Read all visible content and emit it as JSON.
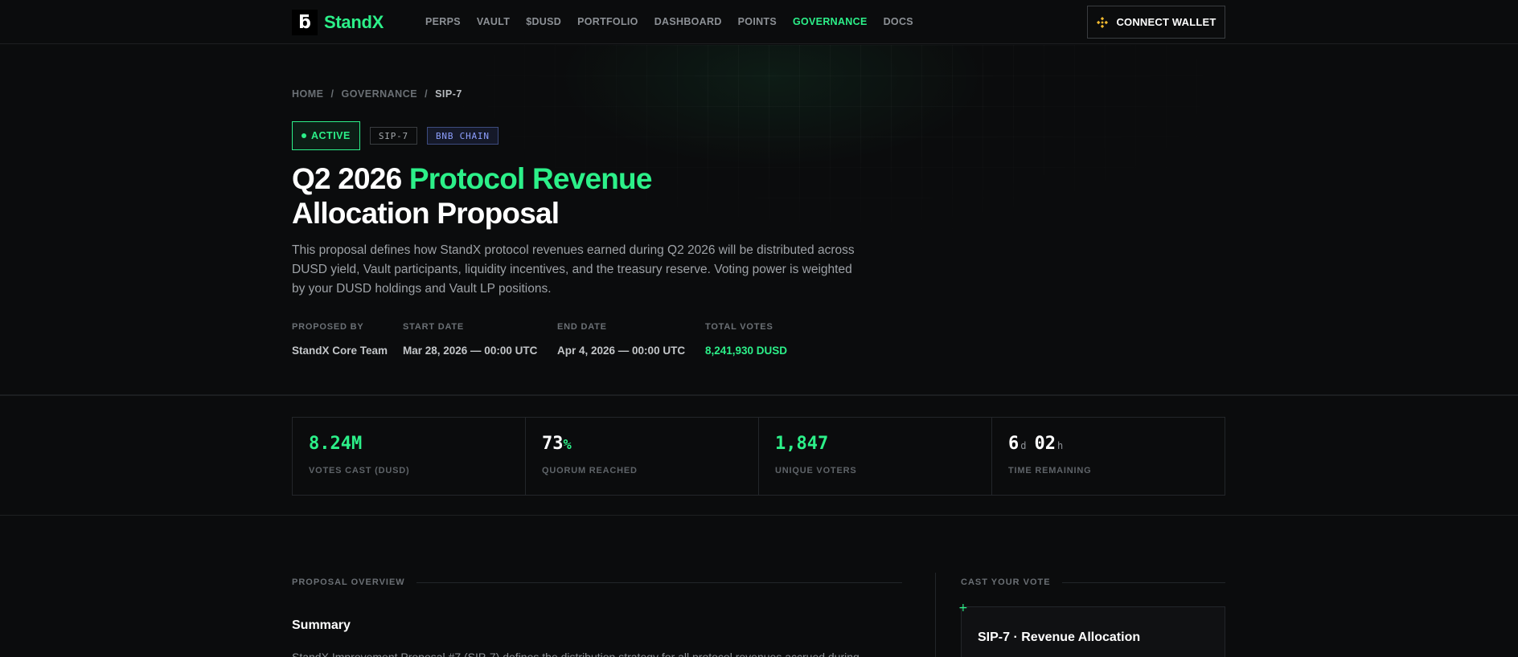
{
  "nav": {
    "logo_mark": "ƃ",
    "logo_text": "StandX",
    "links": [
      "PERPS",
      "VAULT",
      "$DUSD",
      "PORTFOLIO",
      "DASHBOARD",
      "POINTS",
      "GOVERNANCE",
      "DOCS"
    ],
    "active_link": "GOVERNANCE",
    "connect_label": "CONNECT WALLET",
    "connect_icon": "bnb-icon"
  },
  "breadcrumb": {
    "home": "HOME",
    "sep1": "/",
    "governance": "GOVERNANCE",
    "sep2": "/",
    "current": "SIP-7"
  },
  "tags": {
    "status": "ACTIVE",
    "sip": "SIP-7",
    "chain": "BNB CHAIN"
  },
  "hero": {
    "title_part1": "Q2 2026 ",
    "title_highlight": "Protocol Revenue",
    "title_part2": "Allocation Proposal",
    "description": "This proposal defines how StandX protocol revenues earned during Q2 2026 will be distributed across DUSD yield, Vault participants, liquidity incentives, and the treasury reserve. Voting power is weighted by your DUSD holdings and Vault LP positions."
  },
  "meta": {
    "proposed_by_label": "PROPOSED BY",
    "proposed_by": "StandX Core Team",
    "start_label": "START DATE",
    "start": "Mar 28, 2026 — 00:00 UTC",
    "end_label": "END DATE",
    "end": "Apr 4, 2026 — 00:00 UTC",
    "votes_label": "TOTAL VOTES",
    "votes": "8,241,930 DUSD"
  },
  "stats": {
    "votes_cast": "8.24M",
    "votes_cast_label": "VOTES CAST (DUSD)",
    "quorum_value": "73",
    "quorum_unit": "%",
    "quorum_label": "QUORUM REACHED",
    "unique_voters": "1,847",
    "unique_voters_label": "UNIQUE VOTERS",
    "time_days": "6",
    "time_days_unit": "d",
    "time_hours": "02",
    "time_hours_unit": "h",
    "time_label": "TIME REMAINING"
  },
  "overview": {
    "section_label": "PROPOSAL OVERVIEW",
    "summary_heading": "Summary",
    "summary_text": "StandX Improvement Proposal #7 (SIP-7) defines the distribution strategy for all protocol revenues accrued during"
  },
  "vote": {
    "section_label": "CAST YOUR VOTE",
    "card_title": "SIP-7 · Revenue Allocation"
  },
  "colors": {
    "accent": "#2cf089",
    "background": "#0b0c0d",
    "chain_tag": "#8ea0ff"
  }
}
